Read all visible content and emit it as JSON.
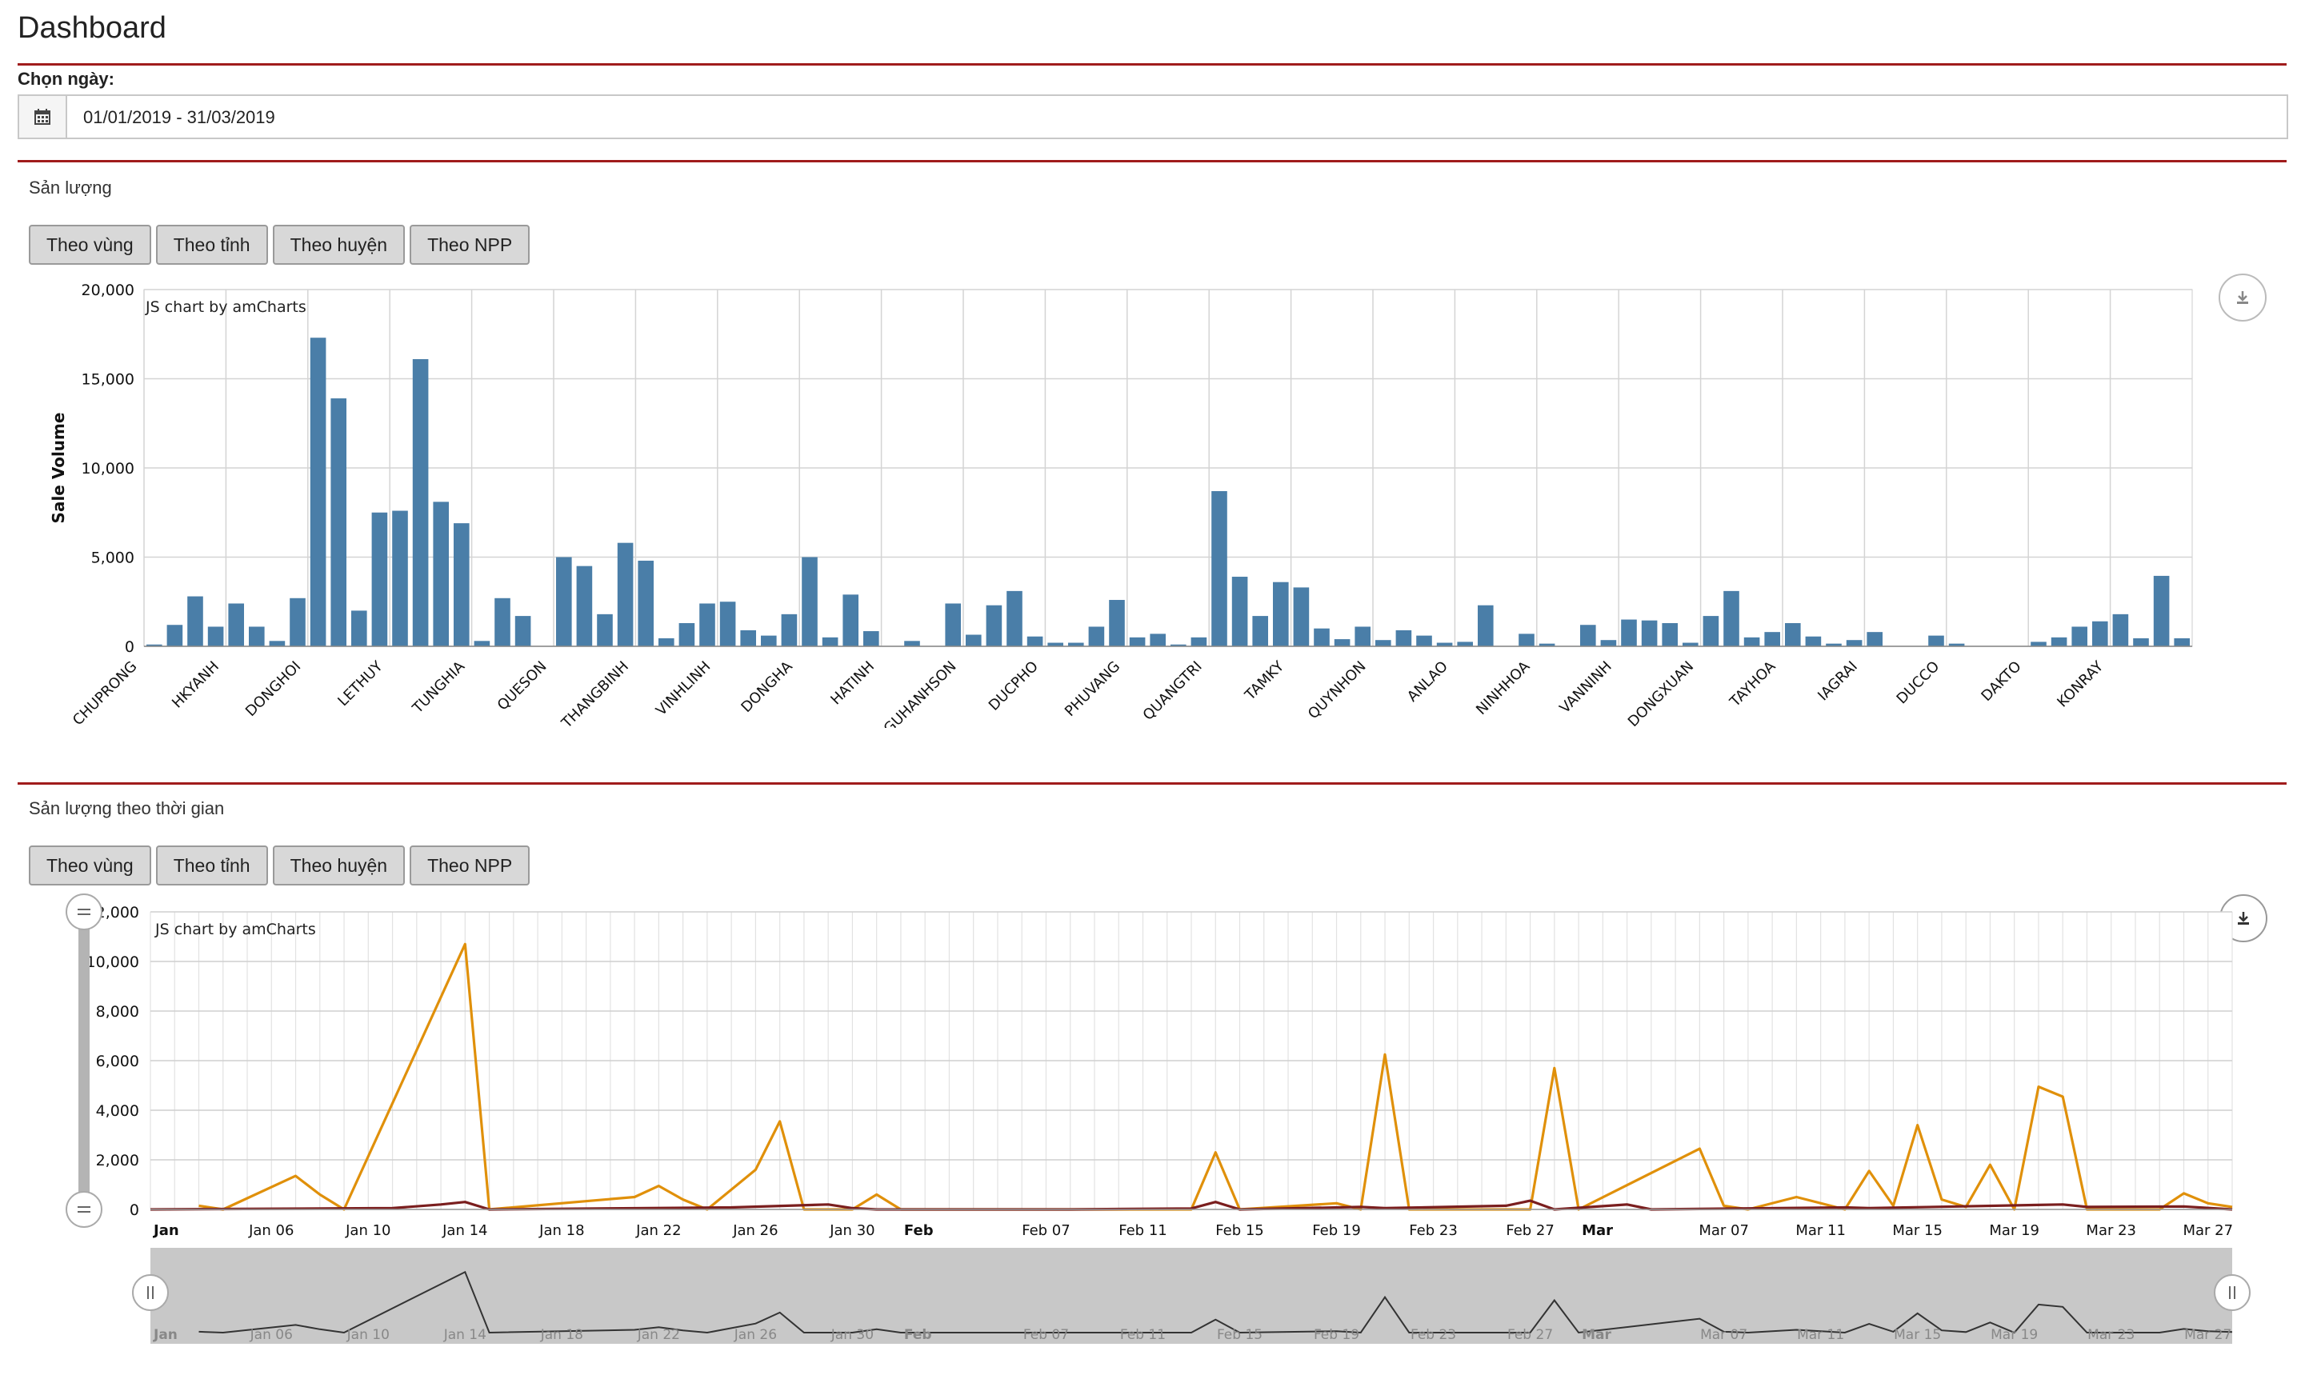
{
  "page": {
    "title": "Dashboard"
  },
  "date_filter": {
    "label": "Chọn ngày:",
    "value": "01/01/2019 - 31/03/2019",
    "icon": "calendar-icon"
  },
  "section1": {
    "title": "Sản lượng",
    "buttons": [
      "Theo vùng",
      "Theo tỉnh",
      "Theo huyện",
      "Theo NPP"
    ],
    "credit": "JS chart by amCharts",
    "download_icon": "download-icon"
  },
  "section2": {
    "title": "Sản lượng theo thời gian",
    "buttons": [
      "Theo vùng",
      "Theo tỉnh",
      "Theo huyện",
      "Theo NPP"
    ],
    "credit": "JS chart by amCharts",
    "download_icon": "download-icon"
  },
  "chart_data": [
    {
      "type": "bar",
      "xlabel": "",
      "ylabel": "Sale Volume",
      "ylim": [
        0,
        20000
      ],
      "yticks": [
        0,
        5000,
        10000,
        15000,
        20000
      ],
      "ytick_labels": [
        "0",
        "5,000",
        "10,000",
        "15,000",
        "20,000"
      ],
      "grid": true,
      "color": "#4a7ea8",
      "category_labels": [
        "CHUPRONG",
        "HKYANH",
        "DONGHOI",
        "LETHUY",
        "TUNGHIA",
        "QUESON",
        "THANGBINH",
        "VINHLINH",
        "DONGHA",
        "HATINH",
        "NGUHANHSON",
        "DUCPHO",
        "PHUVANG",
        "QUANGTRI",
        "TAMKY",
        "QUYNHON",
        "ANLAO",
        "NINHHOA",
        "VANNINH",
        "DONGXUAN",
        "TAYHOA",
        "IAGRAI",
        "DUCCO",
        "DAKTO",
        "KONRAY"
      ],
      "values": [
        100,
        1200,
        2800,
        1100,
        2400,
        1100,
        300,
        2700,
        17300,
        13900,
        2000,
        7500,
        7600,
        16100,
        8100,
        6900,
        300,
        2700,
        1700,
        0,
        5000,
        4500,
        1800,
        5800,
        4800,
        450,
        1300,
        2400,
        2500,
        900,
        600,
        1800,
        5000,
        500,
        2900,
        850,
        0,
        300,
        0,
        2400,
        650,
        2300,
        3100,
        550,
        200,
        200,
        1100,
        2600,
        500,
        700,
        100,
        500,
        8700,
        3900,
        1700,
        3600,
        3300,
        1000,
        400,
        1100,
        350,
        900,
        600,
        200,
        250,
        2300,
        0,
        700,
        150,
        0,
        1200,
        350,
        1500,
        1450,
        1300,
        200,
        1700,
        3100,
        500,
        800,
        1300,
        550,
        150,
        350,
        800,
        0,
        0,
        600,
        150,
        0,
        0,
        0,
        250,
        500,
        1100,
        1400,
        1800,
        450,
        3950,
        450
      ]
    },
    {
      "type": "line",
      "xlabel": "",
      "ylabel": "",
      "ylim": [
        0,
        12000
      ],
      "yticks": [
        0,
        2000,
        4000,
        6000,
        8000,
        10000,
        12000
      ],
      "ytick_labels": [
        "0",
        "2,000",
        "4,000",
        "6,000",
        "8,000",
        "10,000",
        "12,000"
      ],
      "x_start": "2019-01-01",
      "x_end": "2019-03-28",
      "x_tick_labels": [
        "Jan",
        "Jan 06",
        "Jan 10",
        "Jan 14",
        "Jan 18",
        "Jan 22",
        "Jan 26",
        "Jan 30",
        "Feb",
        "Feb 07",
        "Feb 11",
        "Feb 15",
        "Feb 19",
        "Feb 23",
        "Feb 27",
        "Mar",
        "Mar 07",
        "Mar 11",
        "Mar 15",
        "Mar 19",
        "Mar 23",
        "Mar 27"
      ],
      "x_tick_bold": [
        "Jan",
        "Feb",
        "Mar"
      ],
      "grid": true,
      "series": [
        {
          "color": "#e0900a",
          "points": [
            [
              "2019-01-03",
              150
            ],
            [
              "2019-01-04",
              0
            ],
            [
              "2019-01-07",
              1350
            ],
            [
              "2019-01-08",
              600
            ],
            [
              "2019-01-09",
              0
            ],
            [
              "2019-01-14",
              10700
            ],
            [
              "2019-01-15",
              0
            ],
            [
              "2019-01-21",
              500
            ],
            [
              "2019-01-22",
              950
            ],
            [
              "2019-01-23",
              400
            ],
            [
              "2019-01-24",
              0
            ],
            [
              "2019-01-26",
              1600
            ],
            [
              "2019-01-27",
              3550
            ],
            [
              "2019-01-28",
              0
            ],
            [
              "2019-01-30",
              0
            ],
            [
              "2019-01-31",
              600
            ],
            [
              "2019-02-01",
              0
            ],
            [
              "2019-02-13",
              0
            ],
            [
              "2019-02-14",
              2300
            ],
            [
              "2019-02-15",
              0
            ],
            [
              "2019-02-19",
              250
            ],
            [
              "2019-02-20",
              0
            ],
            [
              "2019-02-21",
              6250
            ],
            [
              "2019-02-22",
              0
            ],
            [
              "2019-02-27",
              0
            ],
            [
              "2019-02-28",
              5700
            ],
            [
              "2019-03-01",
              0
            ],
            [
              "2019-03-06",
              2450
            ],
            [
              "2019-03-07",
              150
            ],
            [
              "2019-03-08",
              0
            ],
            [
              "2019-03-10",
              500
            ],
            [
              "2019-03-12",
              0
            ],
            [
              "2019-03-13",
              1550
            ],
            [
              "2019-03-14",
              150
            ],
            [
              "2019-03-15",
              3400
            ],
            [
              "2019-03-16",
              400
            ],
            [
              "2019-03-17",
              100
            ],
            [
              "2019-03-18",
              1800
            ],
            [
              "2019-03-19",
              0
            ],
            [
              "2019-03-20",
              4950
            ],
            [
              "2019-03-21",
              4550
            ],
            [
              "2019-03-22",
              0
            ],
            [
              "2019-03-25",
              0
            ],
            [
              "2019-03-26",
              650
            ],
            [
              "2019-03-27",
              250
            ],
            [
              "2019-03-28",
              100
            ]
          ]
        },
        {
          "color": "#7a1e1e",
          "points": [
            [
              "2019-01-01",
              0
            ],
            [
              "2019-01-11",
              50
            ],
            [
              "2019-01-13",
              200
            ],
            [
              "2019-01-14",
              300
            ],
            [
              "2019-01-15",
              0
            ],
            [
              "2019-01-25",
              80
            ],
            [
              "2019-01-29",
              200
            ],
            [
              "2019-01-30",
              50
            ],
            [
              "2019-01-31",
              0
            ],
            [
              "2019-02-08",
              0
            ],
            [
              "2019-02-13",
              40
            ],
            [
              "2019-02-14",
              300
            ],
            [
              "2019-02-15",
              0
            ],
            [
              "2019-02-20",
              100
            ],
            [
              "2019-02-21",
              50
            ],
            [
              "2019-02-26",
              150
            ],
            [
              "2019-02-27",
              350
            ],
            [
              "2019-02-28",
              0
            ],
            [
              "2019-03-03",
              200
            ],
            [
              "2019-03-04",
              0
            ],
            [
              "2019-03-12",
              80
            ],
            [
              "2019-03-13",
              50
            ],
            [
              "2019-03-21",
              200
            ],
            [
              "2019-03-22",
              100
            ],
            [
              "2019-03-26",
              120
            ],
            [
              "2019-03-28",
              0
            ]
          ]
        }
      ]
    }
  ]
}
